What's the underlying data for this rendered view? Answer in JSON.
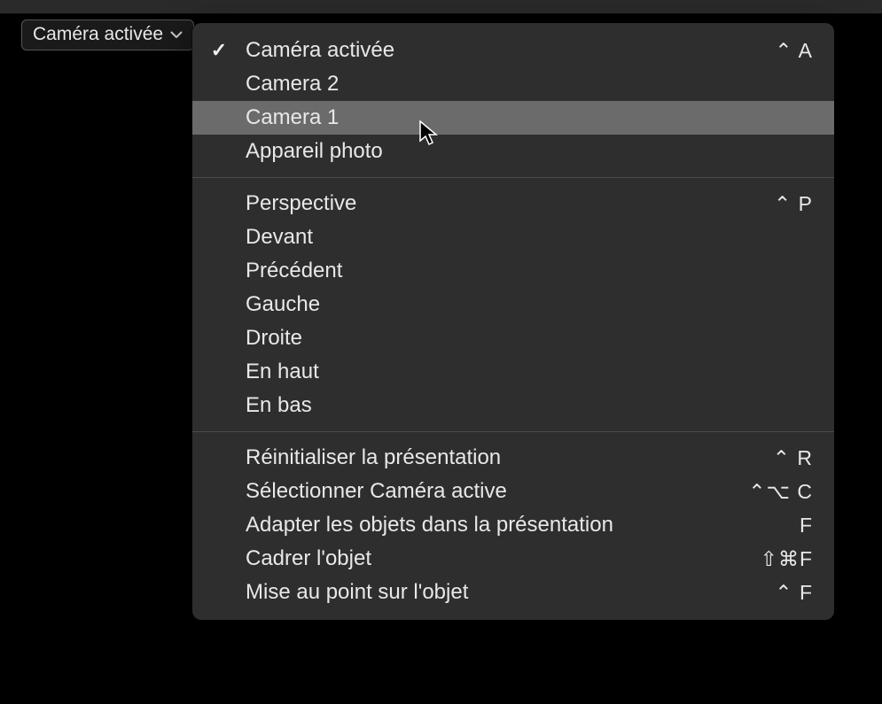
{
  "dropdown": {
    "label": "Caméra activée"
  },
  "menu": {
    "section1": [
      {
        "label": "Caméra activée",
        "shortcut": "⌃ A",
        "checked": true,
        "highlighted": false
      },
      {
        "label": "Camera 2",
        "shortcut": "",
        "checked": false,
        "highlighted": false
      },
      {
        "label": "Camera 1",
        "shortcut": "",
        "checked": false,
        "highlighted": true
      },
      {
        "label": "Appareil photo",
        "shortcut": "",
        "checked": false,
        "highlighted": false
      }
    ],
    "section2": [
      {
        "label": "Perspective",
        "shortcut": "⌃ P",
        "checked": false,
        "highlighted": false
      },
      {
        "label": "Devant",
        "shortcut": "",
        "checked": false,
        "highlighted": false
      },
      {
        "label": "Précédent",
        "shortcut": "",
        "checked": false,
        "highlighted": false
      },
      {
        "label": "Gauche",
        "shortcut": "",
        "checked": false,
        "highlighted": false
      },
      {
        "label": "Droite",
        "shortcut": "",
        "checked": false,
        "highlighted": false
      },
      {
        "label": "En haut",
        "shortcut": "",
        "checked": false,
        "highlighted": false
      },
      {
        "label": "En bas",
        "shortcut": "",
        "checked": false,
        "highlighted": false
      }
    ],
    "section3": [
      {
        "label": "Réinitialiser la présentation",
        "shortcut": "⌃ R",
        "checked": false,
        "highlighted": false
      },
      {
        "label": "Sélectionner Caméra active",
        "shortcut": "⌃⌥ C",
        "checked": false,
        "highlighted": false
      },
      {
        "label": "Adapter les objets dans la présentation",
        "shortcut": "F",
        "checked": false,
        "highlighted": false
      },
      {
        "label": "Cadrer l'objet",
        "shortcut": "⇧⌘F",
        "checked": false,
        "highlighted": false
      },
      {
        "label": "Mise au point sur l'objet",
        "shortcut": "⌃ F",
        "checked": false,
        "highlighted": false
      }
    ]
  }
}
